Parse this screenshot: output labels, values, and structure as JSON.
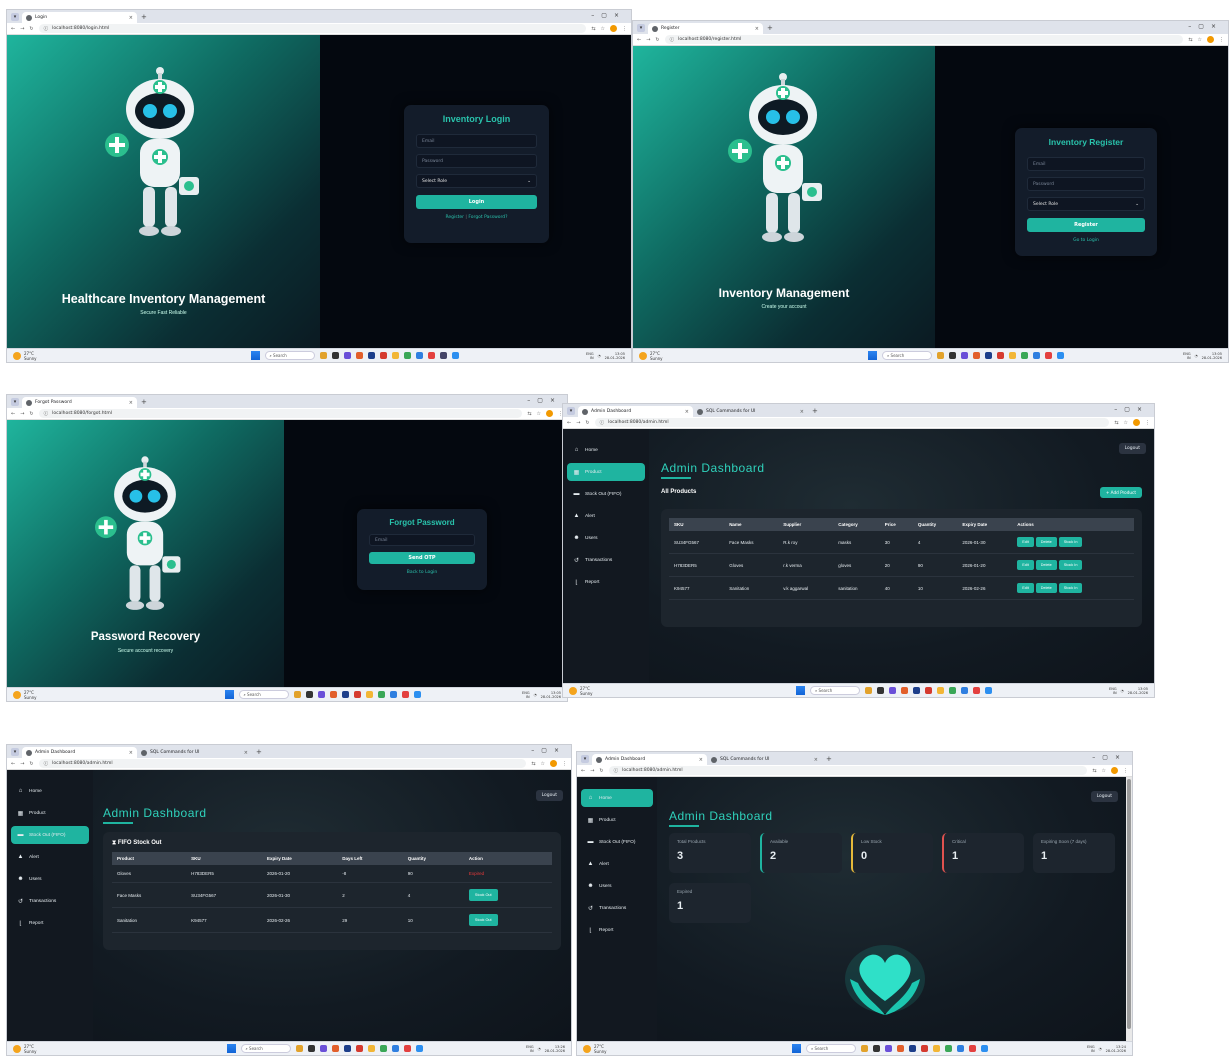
{
  "login": {
    "tab_title": "Login",
    "url": "localhost:8080/login.html",
    "hero_title": "Healthcare Inventory Management",
    "hero_sub": "Secure Fast Reliable",
    "card_title": "Inventory Login",
    "email_ph": "Email",
    "password_ph": "Password",
    "role": "Select Role",
    "btn": "Login",
    "register_link": "Register",
    "sep": "|",
    "forgot_link": "Forgot Password?"
  },
  "register": {
    "tab_title": "Register",
    "url": "localhost:8080/register.html",
    "hero_title": "Inventory Management",
    "hero_sub": "Create your account",
    "card_title": "Inventory Register",
    "email_ph": "Email",
    "password_ph": "Password",
    "role": "Select Role",
    "btn": "Register",
    "link": "Go to Login"
  },
  "forgot": {
    "tab_title": "Forgot Password",
    "url": "localhost:8080/forgot.html",
    "hero_title": "Password Recovery",
    "hero_sub": "Secure account recovery",
    "card_title": "Forgot Password",
    "email_ph": "Email",
    "btn": "Send OTP",
    "link": "Back to Login"
  },
  "dashboard": {
    "tab_title": "Admin Dashboard",
    "tab2_title": "SQL Commands for UI",
    "url": "localhost:8080/admin.html",
    "title": "Admin Dashboard",
    "logout": "Logout",
    "sidebar": [
      "Home",
      "Product",
      "Stock Out (FIFO)",
      "Alert",
      "Users",
      "Transactions",
      "Report"
    ]
  },
  "products": {
    "heading": "All Products",
    "add_btn": "+ Add Product",
    "headers": [
      "SKU",
      "Name",
      "Supplier",
      "Category",
      "Price",
      "Quantity",
      "Expiry Date",
      "Actions"
    ],
    "rows": [
      {
        "sku": "SU34FG567",
        "name": "Face Masks",
        "supplier": "R.k roy",
        "category": "masks",
        "price": "30",
        "qty": "4",
        "expiry": "2026-01-30"
      },
      {
        "sku": "H783DER5",
        "name": "Gloves",
        "supplier": "r.k verma",
        "category": "gloves",
        "price": "20",
        "qty": "90",
        "expiry": "2026-01-20"
      },
      {
        "sku": "K94577",
        "name": "Sanitation",
        "supplier": "v.k aggarwal",
        "category": "sanitation",
        "price": "40",
        "qty": "10",
        "expiry": "2026-02-26"
      }
    ],
    "edit": "Edit",
    "delete": "Delete",
    "stock_in": "Stock In"
  },
  "fifo": {
    "heading": "FIFO Stock Out",
    "headers": [
      "Product",
      "SKU",
      "Expiry Date",
      "Days Left",
      "Quantity",
      "Action"
    ],
    "rows": [
      {
        "product": "Gloves",
        "sku": "H783DER5",
        "expiry": "2026-01-20",
        "days": "-8",
        "qty": "90",
        "action": "Expired"
      },
      {
        "product": "Face Masks",
        "sku": "SU34FG567",
        "expiry": "2026-01-30",
        "days": "2",
        "qty": "4",
        "action": "Stock Out"
      },
      {
        "product": "Sanitation",
        "sku": "K94577",
        "expiry": "2026-02-26",
        "days": "29",
        "qty": "10",
        "action": "Stock Out"
      }
    ]
  },
  "home": {
    "stats": [
      {
        "label": "Total Products",
        "value": "3",
        "color": ""
      },
      {
        "label": "Available",
        "value": "2",
        "color": "#1fb4a0"
      },
      {
        "label": "Low Stock",
        "value": "0",
        "color": "#e6b93a"
      },
      {
        "label": "Critical",
        "value": "1",
        "color": "#e0524f"
      },
      {
        "label": "Expiring Soon (7 days)",
        "value": "1",
        "color": ""
      },
      {
        "label": "Expired",
        "value": "1",
        "color": ""
      }
    ]
  },
  "taskbar": {
    "temp": "27°C",
    "weather": "Sunny",
    "search": "Search",
    "lang": "ENG",
    "region": "IN",
    "time1": "13:05",
    "time2": "13:26",
    "time3": "13:24",
    "date": "28-01-2026"
  },
  "colors": {
    "accent": "#1fb4a0",
    "title": "#2fd1bb",
    "bg": "#0c1220"
  }
}
